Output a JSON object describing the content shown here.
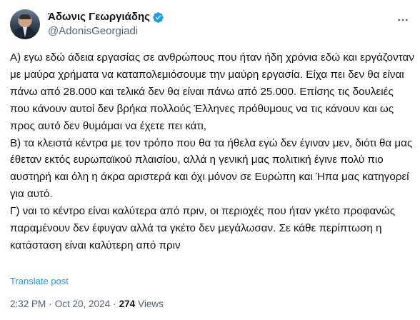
{
  "author": {
    "display_name": "Άδωνις Γεωργιάδης",
    "handle": "@AdonisGeorgiadi",
    "verified": true
  },
  "tweet": {
    "paragraphs": [
      "Α) εγω εδώ άδεια εργασίας σε ανθρώπους που ήταν ήδη χρόνια εδώ και εργάζονταν με μαύρα χρήματα να καταπολεμιόσουμε την μαύρη εργασία. Είχα πει δεν θα είναι πάνω από 28.000 και τελικά δεν θα είναι πάνω από 25.000. Επίσης τις δουλειές που κάνουν αυτοί δεν βρήκα πολλούς Έλληνες πρόθυμους να τις κάνουν και ως προς αυτό δεν θυμάμαι να έχετε πει κάτι,",
      "Β) τα κλειστά κέντρα με τον τρόπο που θα τα ήθελα εγώ δεν έγιναν μεν, διότι θα μας έθεταν εκτός ευρωπαϊκού πλαισίου, αλλά η γενική μας πολιτική έγινε πολύ πιο αυστηρή και όλη η άκρα αριστερά και όχι μόνον σε Ευρώπη και Ήπα μας κατηγορεί για αυτό.",
      "Γ) ναι το κέντρο είναι καλύτερα από πριν, οι περιοχές που ήταν γκέτο προφανώς παραμένουν δεν έφυγαν αλλά τα γκέτο δεν μεγάλωσαν. Σε κάθε περίπτωση η κατάσταση είναι καλύτερη από πριν"
    ],
    "translate_label": "Translate post",
    "time": "2:32 PM",
    "separator": "·",
    "date": "Oct 20, 2024",
    "views_count": "274",
    "views_label": "Views"
  },
  "icons": {
    "verified": "verified-badge-icon",
    "more": "more-options-icon"
  },
  "colors": {
    "text": "#0f1419",
    "secondary": "#536471",
    "link": "#1d9bf0",
    "verified": "#1d9bf0"
  }
}
